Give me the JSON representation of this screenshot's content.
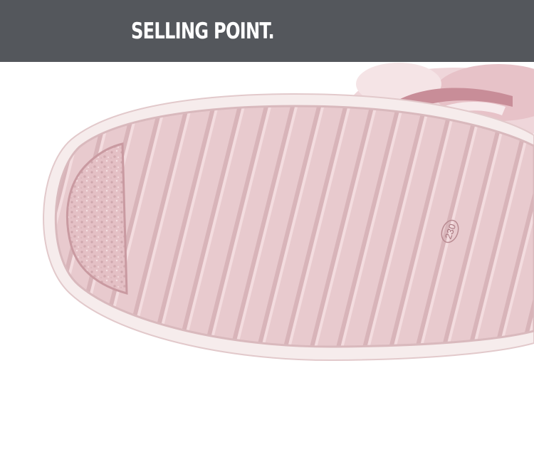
{
  "banner": {
    "title": "SELLING POINT.",
    "background_color": "#54575c",
    "text_color": "#ffffff"
  },
  "photo": {
    "subject": "pink shoe sole with ribbed tread and textured heel pad",
    "sole_color": "#e8c8cb",
    "fur_color": "#f2dde0",
    "size_stamp": "230"
  }
}
